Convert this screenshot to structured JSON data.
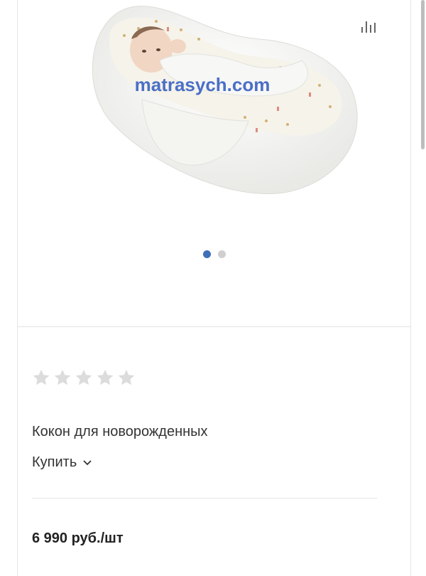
{
  "product": {
    "watermark": "matrasych.com",
    "title": "Кокон для новорожденных",
    "buy_label": "Купить",
    "price": "6 990 руб./шт",
    "rating_stars": 5,
    "rating_filled": 0,
    "gallery_dots": 2,
    "gallery_active": 1
  },
  "icons": {
    "compare": "bar-chart-icon",
    "star": "star-icon",
    "chevron": "chevron-down-icon"
  },
  "colors": {
    "dot_active": "#3f6fb7",
    "dot_inactive": "#cfcfcf",
    "star": "#dcdcdc",
    "watermark": "#4a6fc7"
  }
}
